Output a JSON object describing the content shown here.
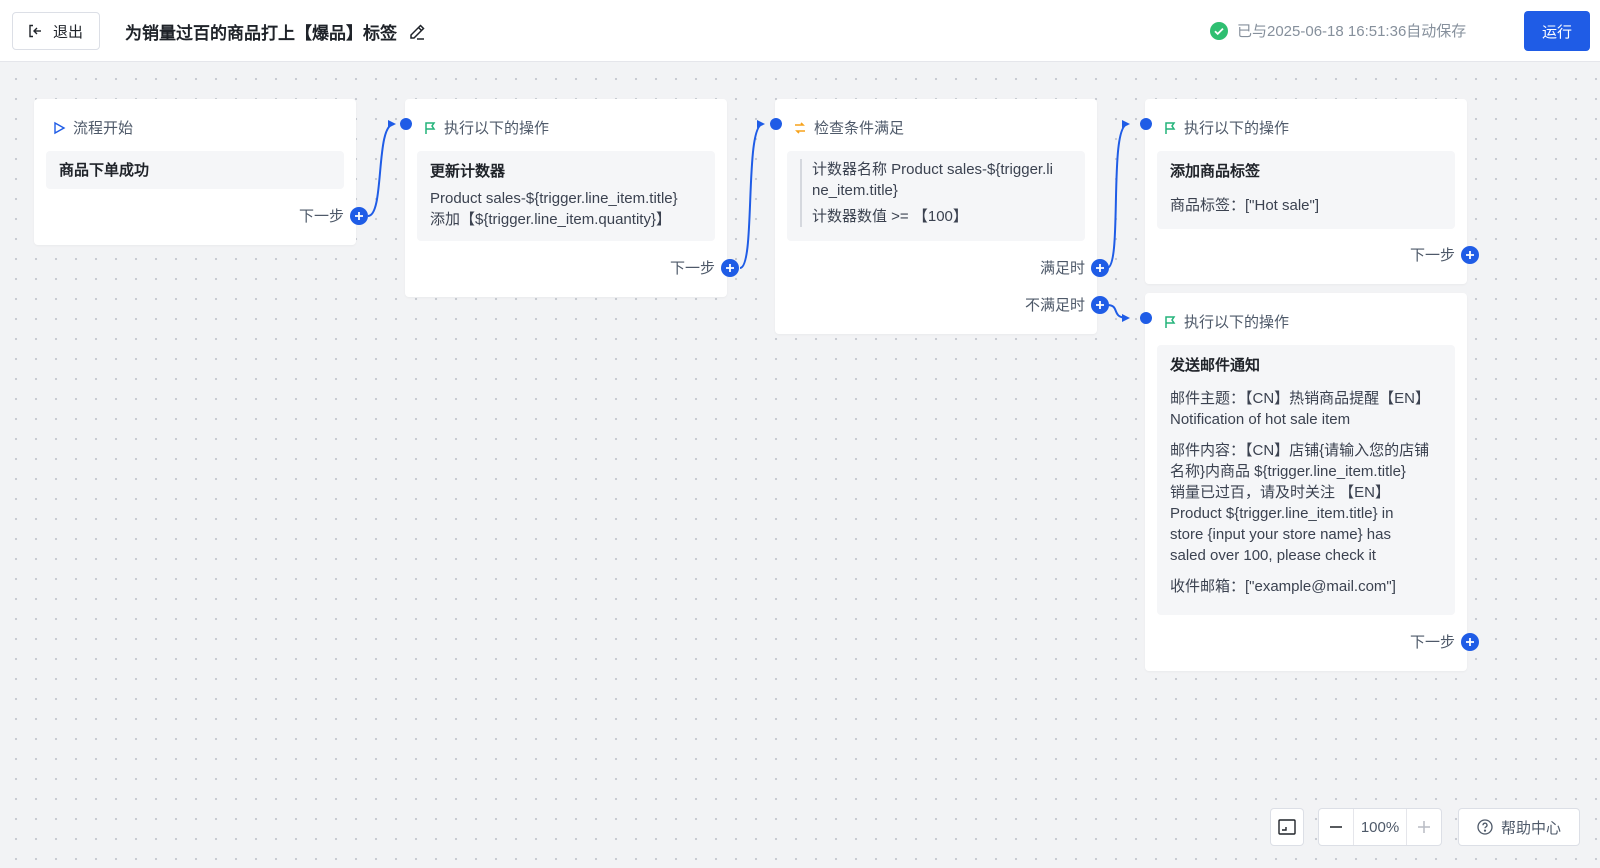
{
  "header": {
    "exit_label": "退出",
    "title": "为销量过百的商品打上【爆品】标签",
    "save_status": "已与2025-06-18 16:51:36自动保存",
    "run_label": "运行"
  },
  "nodes": {
    "start": {
      "header": "流程开始",
      "trigger": "商品下单成功",
      "next_label": "下一步"
    },
    "action1": {
      "header": "执行以下的操作",
      "title": "更新计数器",
      "line1": "Product sales-${trigger.line_item.title}",
      "line2": "添加【${trigger.line_item.quantity}】",
      "next_label": "下一步"
    },
    "condition": {
      "header": "检查条件满足",
      "line1a": "计数器名称 Product sales-${trigger.li",
      "line1b": "ne_item.title}",
      "line2": "计数器数值 >= 【100】",
      "true_label": "满足时",
      "false_label": "不满足时"
    },
    "action2": {
      "header": "执行以下的操作",
      "title": "添加商品标签",
      "line1": "商品标签：[\"Hot sale\"]",
      "next_label": "下一步"
    },
    "action3": {
      "header": "执行以下的操作",
      "title": "发送邮件通知",
      "subject_1": "邮件主题：【CN】热销商品提醒【EN】",
      "subject_2": "Notification of hot sale item",
      "content_1": "邮件内容：【CN】店铺{请输入您的店铺",
      "content_2": "名称}内商品 ${trigger.line_item.title}",
      "content_3": "销量已过百，请及时关注 【EN】",
      "content_4": "Product ${trigger.line_item.title} in",
      "content_5": "store {input your store name} has",
      "content_6": "saled over 100, please check it",
      "recipient": "收件邮箱：[\"example@mail.com\"]",
      "next_label": "下一步"
    }
  },
  "toolbar": {
    "zoom_value": "100%",
    "help_label": "帮助中心"
  },
  "colors": {
    "accent": "#1f5ce6",
    "success": "#2fbf71",
    "action_flag": "#23b37a",
    "condition": "#f7a21b"
  }
}
